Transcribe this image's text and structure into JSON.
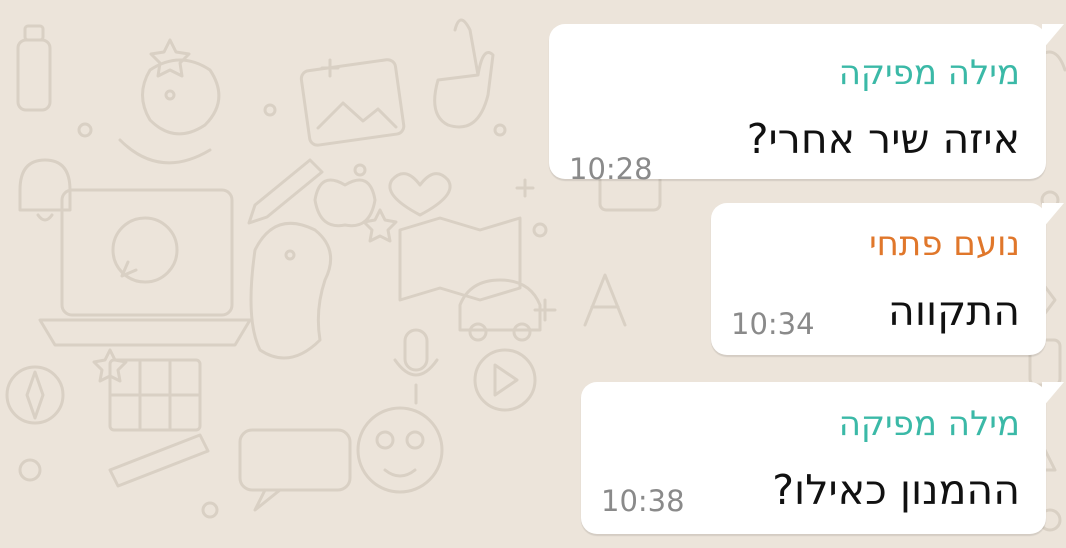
{
  "colors": {
    "background": "#ece4da",
    "bubble": "#ffffff",
    "sender_teal": "#3bb9a7",
    "sender_orange": "#e0772b",
    "timestamp": "#8a8a8a",
    "message_text": "#111111"
  },
  "messages": [
    {
      "sender": "מילה מפיקה",
      "sender_color": "#3bb9a7",
      "text": "איזה שיר אחרי?",
      "time": "10:28"
    },
    {
      "sender": "נועם פתחי",
      "sender_color": "#e0772b",
      "text": "התקווה",
      "time": "10:34"
    },
    {
      "sender": "מילה מפיקה",
      "sender_color": "#3bb9a7",
      "text": "ההמנון כאילו?",
      "time": "10:38"
    }
  ],
  "icons": {
    "wallpaper": "whatsapp-doodle-wallpaper"
  }
}
